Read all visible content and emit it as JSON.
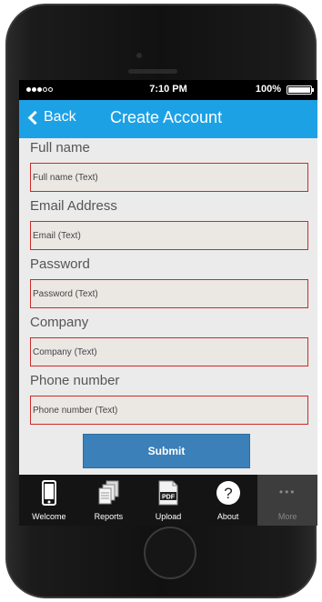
{
  "status_bar": {
    "signal_bars": [
      true,
      true,
      true,
      false,
      false
    ],
    "time": "7:10 PM",
    "battery_text": "100%",
    "battery_level": 1.0
  },
  "nav": {
    "back_label": "Back",
    "title": "Create Account"
  },
  "form": {
    "fields": [
      {
        "label": "Full name",
        "placeholder": "Full name (Text)"
      },
      {
        "label": "Email Address",
        "placeholder": "Email (Text)"
      },
      {
        "label": "Password",
        "placeholder": "Password (Text)"
      },
      {
        "label": "Company",
        "placeholder": "Company (Text)"
      },
      {
        "label": "Phone number",
        "placeholder": "Phone number (Text)"
      }
    ],
    "submit_label": "Submit"
  },
  "tabbar": {
    "tabs": [
      {
        "label": "Welcome",
        "icon": "phone-icon"
      },
      {
        "label": "Reports",
        "icon": "documents-icon"
      },
      {
        "label": "Upload",
        "icon": "pdf-icon",
        "icon_text": "PDF"
      },
      {
        "label": "About",
        "icon": "help-icon",
        "icon_text": "?"
      },
      {
        "label": "More",
        "icon": "more-icon",
        "icon_text": "•••"
      }
    ]
  },
  "colors": {
    "nav_bar": "#1da1e5",
    "submit_button": "#3b80b8",
    "input_border": "#cc2a2a",
    "background": "#ebebeb"
  }
}
